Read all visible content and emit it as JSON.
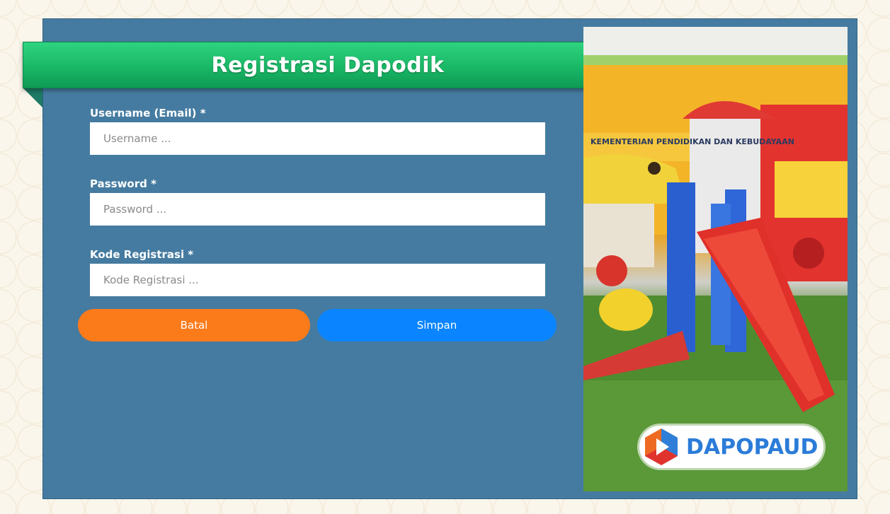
{
  "form": {
    "title": "Registrasi Dapodik",
    "username_label": "Username (Email) *",
    "username_placeholder": "Username ...",
    "password_label": "Password *",
    "password_placeholder": "Password ...",
    "code_label": "Kode Registrasi *",
    "code_placeholder": "Kode Registrasi ...",
    "cancel_label": "Batal",
    "save_label": "Simpan"
  },
  "image": {
    "banner_text": "KEMENTERIAN PENDIDIKAN DAN KEBUDAYAAN",
    "logo_text": "DAPOPAUD"
  },
  "colors": {
    "panel": "#457ba0",
    "ribbon": "#19b866",
    "cancel_button": "#fb7a1a",
    "save_button": "#0a85ff"
  }
}
